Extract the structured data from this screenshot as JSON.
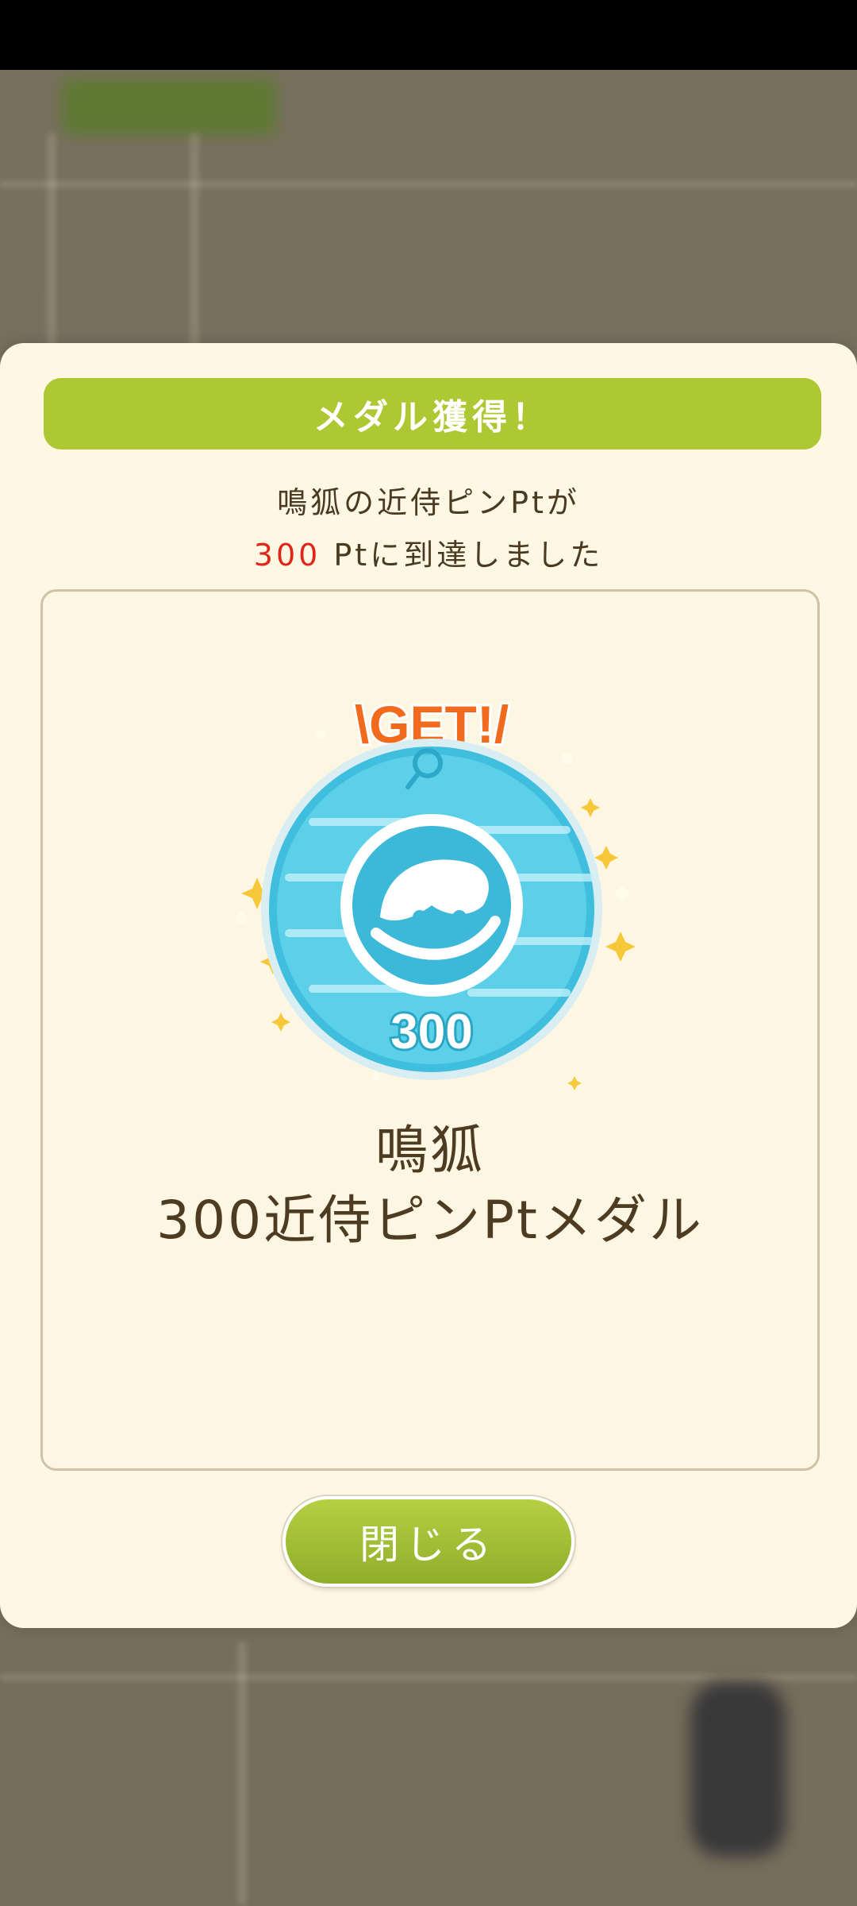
{
  "modal": {
    "header": "メダル獲得！",
    "message_line1": "鳴狐の近侍ピンPtが",
    "message_points": "300",
    "message_line2_rest": " Ptに到達しました",
    "medal": {
      "badge_text": "\\GET!/",
      "value_text": "300",
      "name_line1": "鳴狐",
      "name_line2": "300近侍ピンPtメダル"
    },
    "close_label": "閉じる"
  },
  "colors": {
    "header": "#aec834",
    "points_highlight": "#e0251b",
    "medal": "#45c3e0",
    "get_text": "#f26a1b",
    "button": "#9ab834"
  }
}
